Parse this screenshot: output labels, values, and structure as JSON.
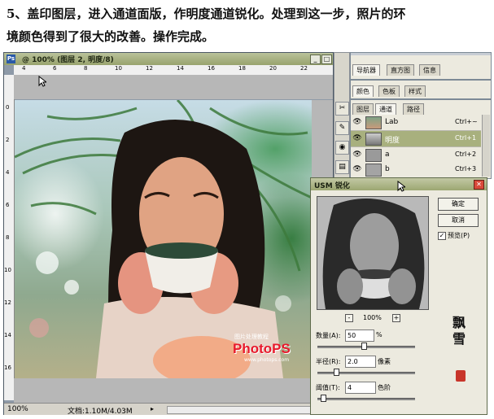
{
  "tutorial": {
    "line1": "5、盖印图层，进入通道面版，作明度通道锐化。处理到这一步，照片的环",
    "line2": "境颜色得到了很大的改善。操作完成。"
  },
  "document": {
    "title": "@ 100% (图层 2, 明度/8)",
    "ps_icon": "Ps",
    "ruler_top": [
      "4",
      "6",
      "8",
      "10",
      "12",
      "14",
      "16",
      "18",
      "20",
      "22"
    ],
    "ruler_left": [
      "0",
      "2",
      "4",
      "6",
      "8",
      "10",
      "12",
      "14",
      "16"
    ],
    "status_zoom": "100%",
    "status_doc": "文档:1.10M/4.03M",
    "watermark_brand": "PhotoPS",
    "watermark_url": "www.photops.com",
    "watermark_cn": "图片处理教程"
  },
  "panels": {
    "top_tabs": [
      "导航器",
      "直方图",
      "信息"
    ],
    "mid_tabs": [
      "颜色",
      "色板",
      "样式"
    ],
    "bot_tabs": [
      "图层",
      "通道",
      "路径"
    ],
    "channels": [
      {
        "name": "Lab",
        "shortcut": "Ctrl+~"
      },
      {
        "name": "明度",
        "shortcut": "Ctrl+1"
      },
      {
        "name": "a",
        "shortcut": "Ctrl+2"
      },
      {
        "name": "b",
        "shortcut": "Ctrl+3"
      }
    ]
  },
  "usm": {
    "title": "USM 锐化",
    "ok": "确定",
    "cancel": "取消",
    "preview": "预览(P)",
    "zoom": "100%",
    "amount_label": "数量(A):",
    "amount_value": "50",
    "amount_unit": "%",
    "radius_label": "半径(R):",
    "radius_value": "2.0",
    "radius_unit": "像素",
    "threshold_label": "阈值(T):",
    "threshold_value": "4",
    "threshold_unit": "色阶"
  },
  "signature": "飘雪"
}
